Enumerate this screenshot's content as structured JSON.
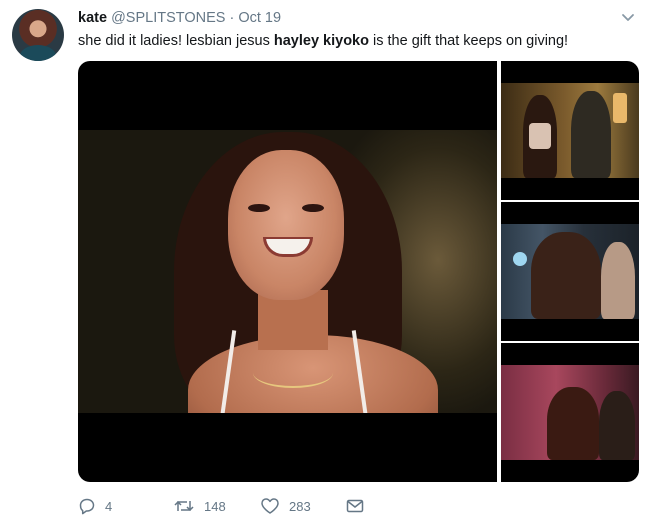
{
  "tweet": {
    "author": {
      "name": "kate",
      "handle": "@SPLITSTONES",
      "separator": "·",
      "date": "Oct 19",
      "avatar_icon": "profile-photo"
    },
    "text": {
      "part1": "she did it ladies! lesbian jesus ",
      "bold": "hayley kiyoko",
      "part2": " is the gift that keeps on giving!"
    },
    "menu_icon": "chevron-down-icon",
    "media": {
      "count": 4
    },
    "actions": {
      "reply": {
        "icon": "reply-icon",
        "count": "4"
      },
      "retweet": {
        "icon": "retweet-icon",
        "count": "148"
      },
      "like": {
        "icon": "heart-icon",
        "count": "283"
      },
      "message": {
        "icon": "envelope-icon"
      }
    }
  },
  "colors": {
    "text_primary": "#14171a",
    "text_secondary": "#657786",
    "background": "#ffffff"
  }
}
